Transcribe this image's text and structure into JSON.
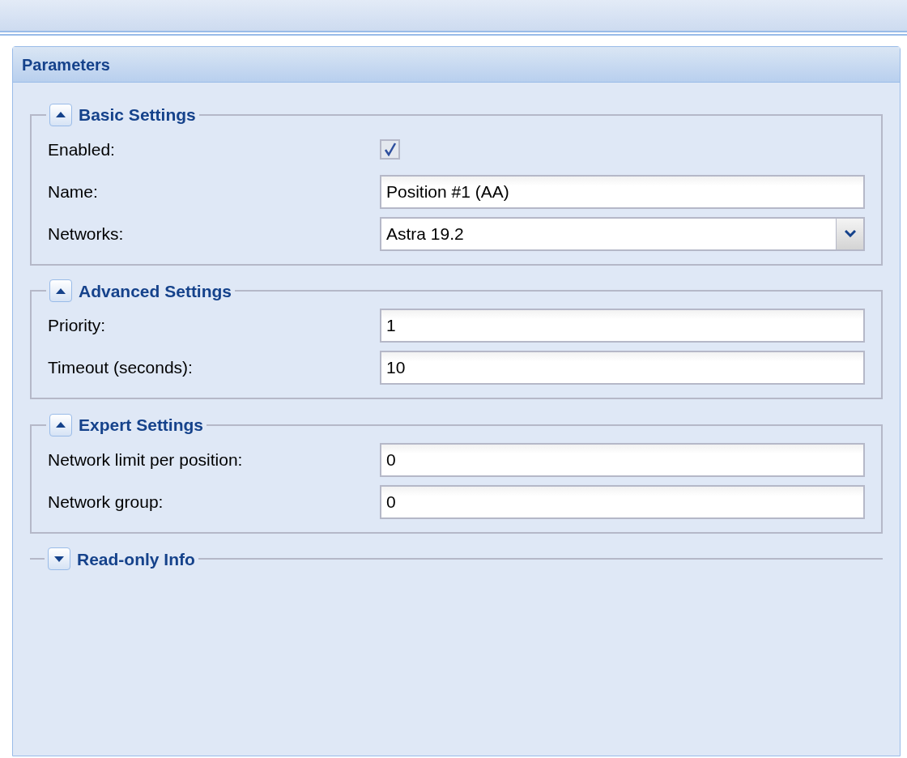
{
  "panel": {
    "title": "Parameters"
  },
  "sections": [
    {
      "title": "Basic Settings",
      "expanded": true,
      "fields": [
        {
          "kind": "checkbox",
          "label": "Enabled:",
          "checked": true
        },
        {
          "kind": "text",
          "label": "Name:",
          "value": "Position #1 (AA)"
        },
        {
          "kind": "select",
          "label": "Networks:",
          "value": "Astra 19.2"
        }
      ]
    },
    {
      "title": "Advanced Settings",
      "expanded": true,
      "fields": [
        {
          "kind": "text",
          "label": "Priority:",
          "value": "1"
        },
        {
          "kind": "text",
          "label": "Timeout (seconds):",
          "value": "10"
        }
      ]
    },
    {
      "title": "Expert Settings",
      "expanded": true,
      "fields": [
        {
          "kind": "text",
          "label": "Network limit per position:",
          "value": "0"
        },
        {
          "kind": "text",
          "label": "Network group:",
          "value": "0"
        }
      ]
    },
    {
      "title": "Read-only Info",
      "expanded": false
    }
  ]
}
